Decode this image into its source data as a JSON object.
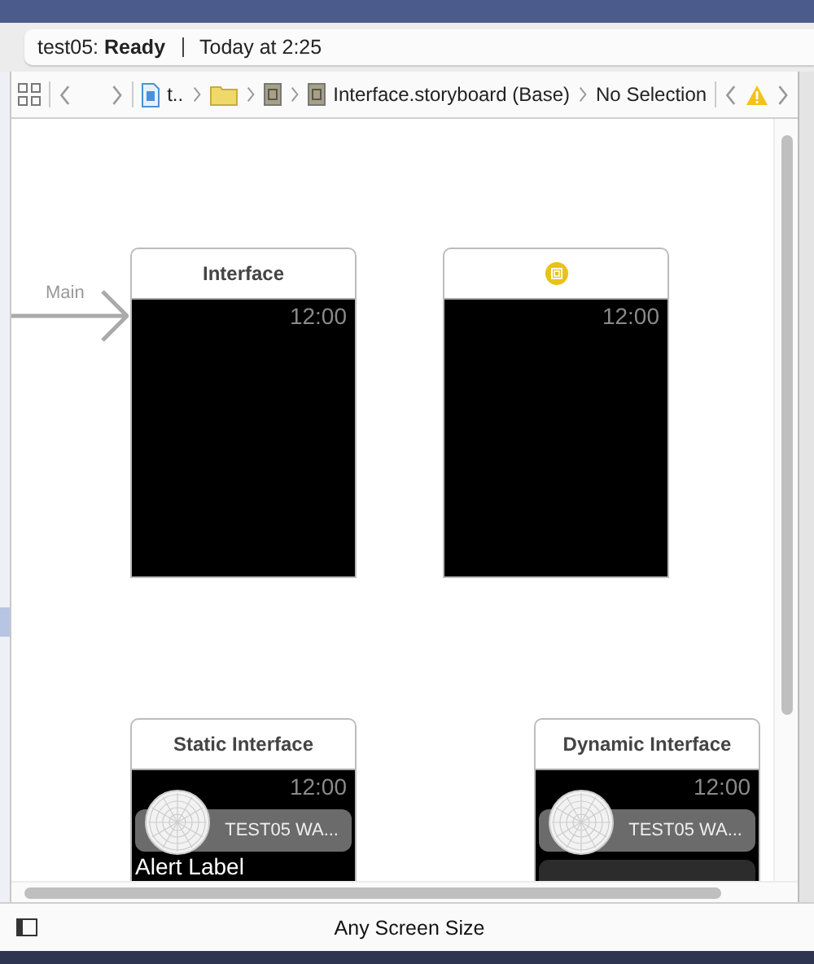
{
  "status": {
    "summary": "test05: **Ready**",
    "time": "Today at 2:25"
  },
  "jump_bar": {
    "items": [
      {
        "kind": "project",
        "label": "t.."
      },
      {
        "kind": "folder"
      },
      {
        "kind": "file"
      },
      {
        "kind": "file",
        "label": "Interface.storyboard (Base)"
      },
      {
        "kind": "text",
        "label": "No Selection"
      }
    ]
  },
  "canvas": {
    "entry_label": "Main",
    "scenes": [
      {
        "kind": "plain",
        "title": "Interface",
        "time": "12:00"
      },
      {
        "kind": "icon",
        "time": "12:00"
      },
      {
        "kind": "notification",
        "title": "Static Interface",
        "time": "12:00",
        "app_name": "TEST05 WA...",
        "alert": "Alert Label"
      },
      {
        "kind": "notification",
        "title": "Dynamic Interface",
        "time": "12:00",
        "app_name": "TEST05 WA..."
      }
    ]
  },
  "bottom_bar": {
    "size_label": "Any Screen Size"
  }
}
